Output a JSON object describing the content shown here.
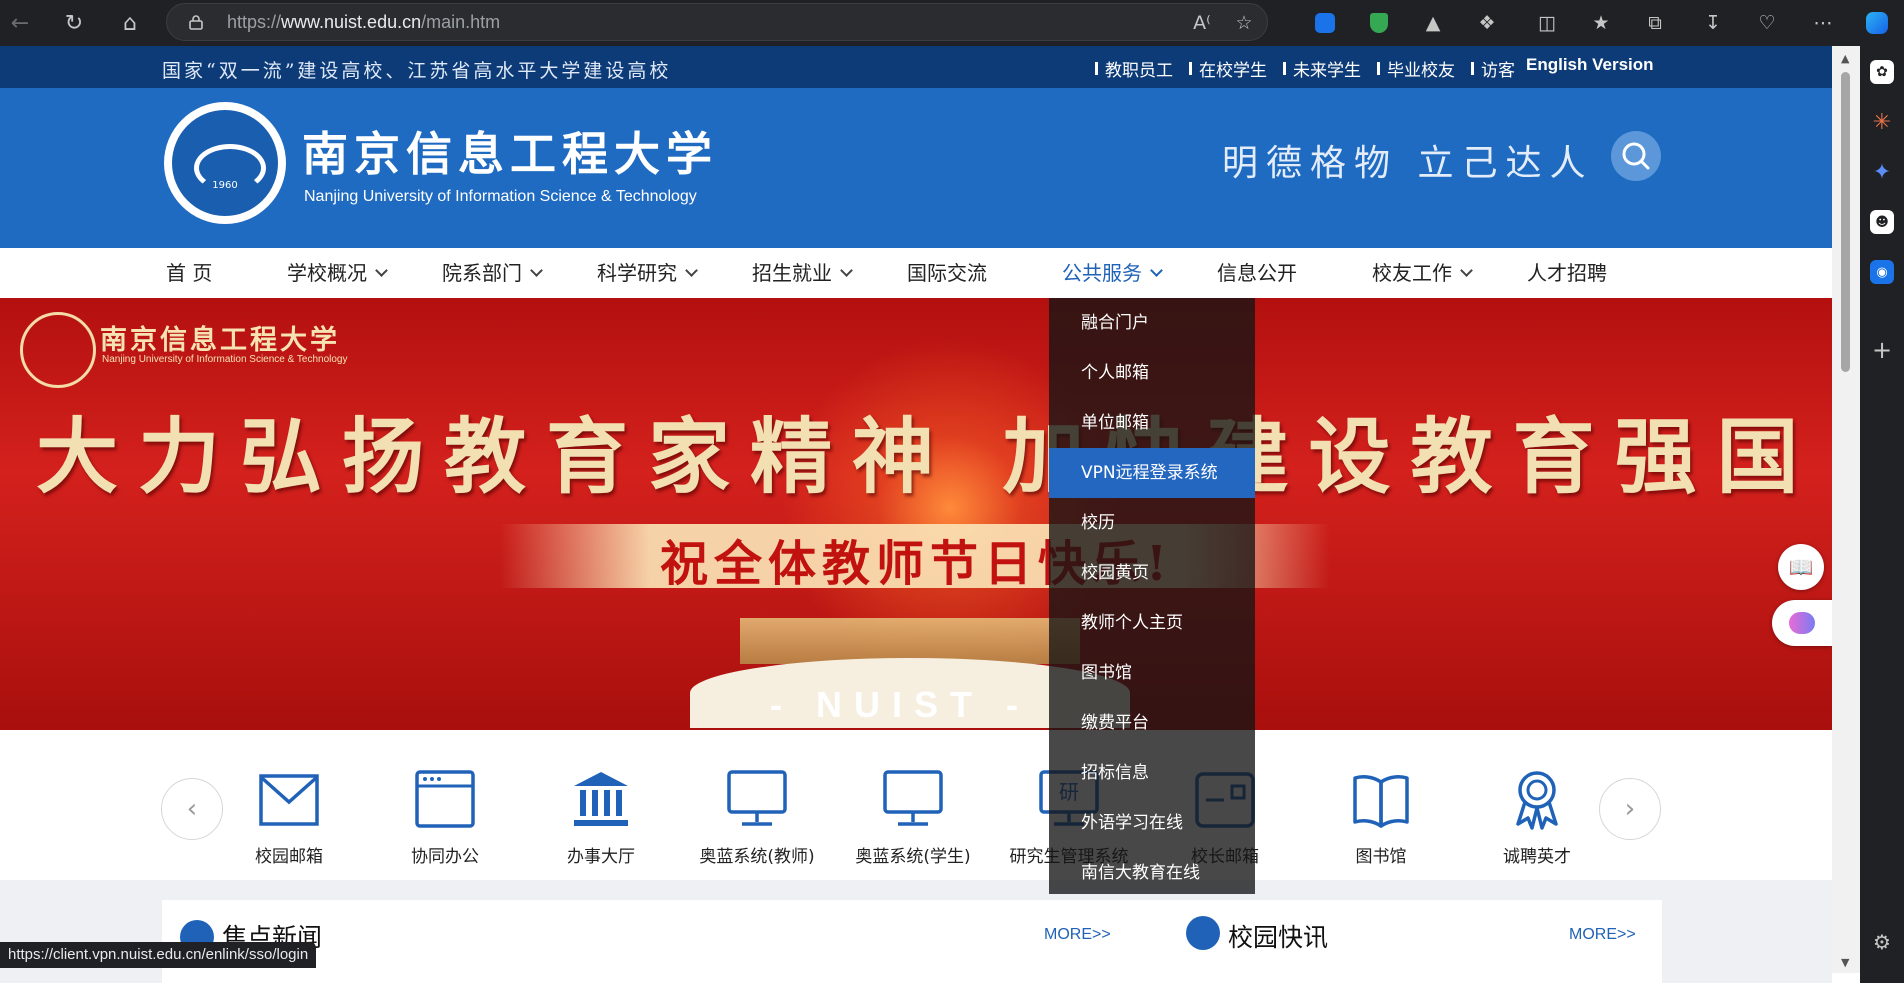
{
  "browser": {
    "url_prefix": "https://",
    "url_host": "www.nuist.edu.cn",
    "url_path": "/main.htm",
    "status_url": "https://client.vpn.nuist.edu.cn/enlink/sso/login"
  },
  "site": {
    "slogan": "国家“双一流”建设高校、江苏省高水平大学建设高校",
    "top_links": [
      "教职员工",
      "在校学生",
      "未来学生",
      "毕业校友",
      "访客"
    ],
    "english_link": "English Version",
    "logo_year": "1960",
    "name_cn": "南京信息工程大学",
    "name_en": "Nanjing University of Information Science & Technology",
    "motto": "明德格物 立己达人"
  },
  "nav": {
    "items": [
      {
        "label": "首 页"
      },
      {
        "label": "学校概况"
      },
      {
        "label": "院系部门"
      },
      {
        "label": "科学研究"
      },
      {
        "label": "招生就业"
      },
      {
        "label": "国际交流"
      },
      {
        "label": "公共服务"
      },
      {
        "label": "信息公开"
      },
      {
        "label": "校友工作"
      },
      {
        "label": "人才招聘"
      }
    ]
  },
  "banner": {
    "logo_cn": "南京信息工程大学",
    "logo_en": "Nanjing University of Information Science & Technology",
    "headline": "大力弘扬教育家精神 加快建设教育强国",
    "subline": "祝全体教师节日快乐!",
    "tag": "- NUIST -"
  },
  "dropdown": {
    "items": [
      {
        "label": "融合门户"
      },
      {
        "label": "个人邮箱"
      },
      {
        "label": "单位邮箱"
      },
      {
        "label": "VPN远程登录系统"
      },
      {
        "label": "校历"
      },
      {
        "label": "校园黄页"
      },
      {
        "label": "教师个人主页"
      },
      {
        "label": "图书馆"
      },
      {
        "label": "缴费平台"
      },
      {
        "label": "招标信息"
      },
      {
        "label": "外语学习在线"
      },
      {
        "label": "南信大教育在线"
      }
    ]
  },
  "quick_links": [
    {
      "label": "校园邮箱",
      "icon": "mail-icon"
    },
    {
      "label": "协同办公",
      "icon": "browser-window-icon"
    },
    {
      "label": "办事大厅",
      "icon": "institution-icon"
    },
    {
      "label": "奥蓝系统(教师)",
      "icon": "monitor-icon"
    },
    {
      "label": "奥蓝系统(学生)",
      "icon": "monitor-icon"
    },
    {
      "label": "研究生管理系统",
      "icon": "graduate-monitor-icon"
    },
    {
      "label": "校长邮箱",
      "icon": "mailbox-icon"
    },
    {
      "label": "图书馆",
      "icon": "book-icon"
    },
    {
      "label": "诚聘英才",
      "icon": "award-icon"
    }
  ],
  "grad_icon_text": "研",
  "news": {
    "left_title": "焦点新闻",
    "left_more": "MORE>>",
    "right_title": "校园快讯",
    "right_more": "MORE>>"
  },
  "colors": {
    "header_blue": "#1f6bc2",
    "top_strip": "#0d3b78",
    "accent": "#2062b8",
    "banner_red": "#c4161c",
    "dropdown_highlight": "#2467c0"
  }
}
